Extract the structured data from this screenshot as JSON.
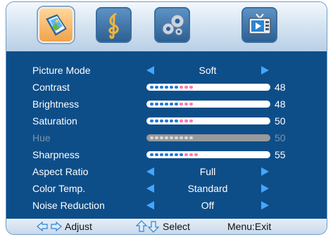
{
  "colors": {
    "osd_blue": "#0d4e89",
    "arrow_blue": "#45a6ff",
    "slider_dot_blue": "#1f79d6",
    "slider_dot_pink": "#ff77a9",
    "disabled_text": "#7f93a8"
  },
  "tabs": [
    {
      "name": "picture-tab",
      "icon": "picture-icon",
      "active": true
    },
    {
      "name": "sound-tab",
      "icon": "music-clef-icon",
      "active": false
    },
    {
      "name": "setup-tab",
      "icon": "gear-icon",
      "active": false
    },
    {
      "name": "features-tab",
      "icon": "tv-icon",
      "active": false
    }
  ],
  "menu": {
    "items": [
      {
        "label": "Picture Mode",
        "type": "option",
        "value": "Soft"
      },
      {
        "label": "Contrast",
        "type": "slider",
        "value": "48",
        "level": 48
      },
      {
        "label": "Brightness",
        "type": "slider",
        "value": "48",
        "level": 48
      },
      {
        "label": "Saturation",
        "type": "slider",
        "value": "50",
        "level": 50
      },
      {
        "label": "Hue",
        "type": "slider",
        "value": "50",
        "level": 50,
        "disabled": true
      },
      {
        "label": "Sharpness",
        "type": "slider",
        "value": "55",
        "level": 55
      },
      {
        "label": "Aspect Ratio",
        "type": "option",
        "value": "Full"
      },
      {
        "label": "Color Temp.",
        "type": "option",
        "value": "Standard"
      },
      {
        "label": "Noise Reduction",
        "type": "option",
        "value": "Off"
      }
    ]
  },
  "footer": {
    "adjust_label": "Adjust",
    "select_label": "Select",
    "menu_exit_label": "Menu:Exit",
    "adjust_icon": "left-right-arrows-icon",
    "select_icon": "up-down-arrows-icon"
  }
}
